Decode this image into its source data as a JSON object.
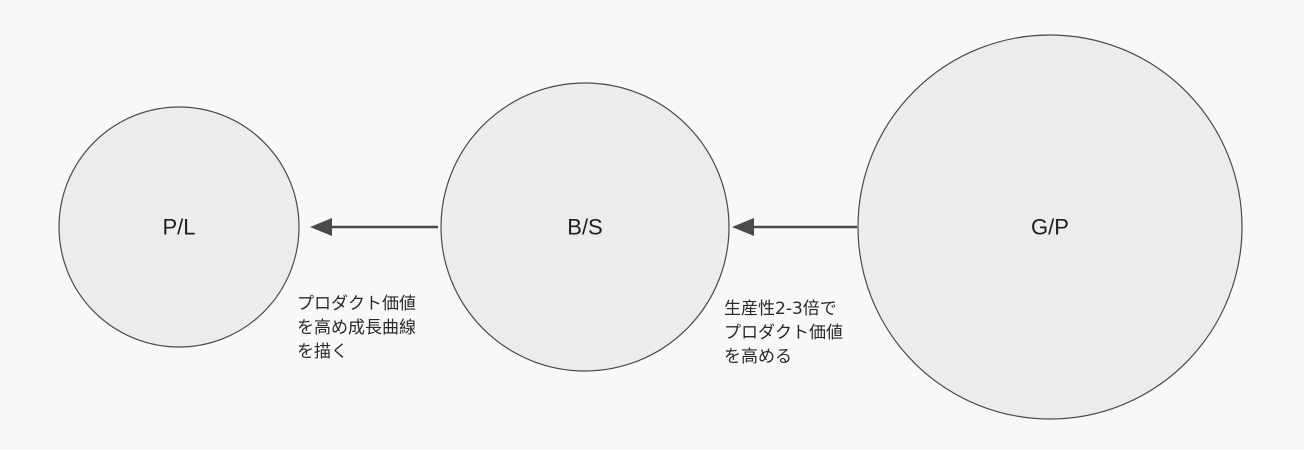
{
  "diagram": {
    "colors": {
      "background": "#f8f8f8",
      "node_fill": "#ececec",
      "node_stroke": "#4a4a4a",
      "arrow": "#4a4a4a",
      "text": "#222222"
    },
    "nodes": [
      {
        "id": "pl",
        "label": "P/L"
      },
      {
        "id": "bs",
        "label": "B/S"
      },
      {
        "id": "gp",
        "label": "G/P"
      }
    ],
    "edges": [
      {
        "from": "bs",
        "to": "pl",
        "label_lines": [
          "プロダクト価値",
          "を高め成長曲線",
          "を描く"
        ]
      },
      {
        "from": "gp",
        "to": "bs",
        "label_lines": [
          "生産性2-3倍で",
          "プロダクト価値",
          "を高める"
        ]
      }
    ]
  }
}
